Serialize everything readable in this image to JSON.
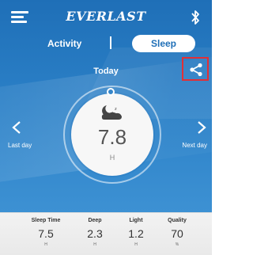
{
  "header": {
    "brand": "EVERLAST"
  },
  "tabs": {
    "activity": "Activity",
    "divider": "|",
    "sleep": "Sleep",
    "active": "sleep"
  },
  "day": {
    "label": "Today",
    "prev_label": "Last day",
    "next_label": "Next day"
  },
  "summary": {
    "value": "7.8",
    "unit": "H"
  },
  "stats": [
    {
      "label": "Sleep Time",
      "value": "7.5",
      "unit": "H"
    },
    {
      "label": "Deep",
      "value": "2.3",
      "unit": "H"
    },
    {
      "label": "Light",
      "value": "1.2",
      "unit": "H"
    },
    {
      "label": "Quality",
      "value": "70",
      "unit": "%"
    }
  ],
  "icons": {
    "menu": "menu-icon",
    "bluetooth": "bluetooth-icon",
    "share": "share-icon",
    "sleep": "sleep-moon-icon",
    "prev": "chevron-left-icon",
    "next": "chevron-right-icon"
  },
  "colors": {
    "primary": "#2a7fc6",
    "highlight": "#e0232a"
  }
}
